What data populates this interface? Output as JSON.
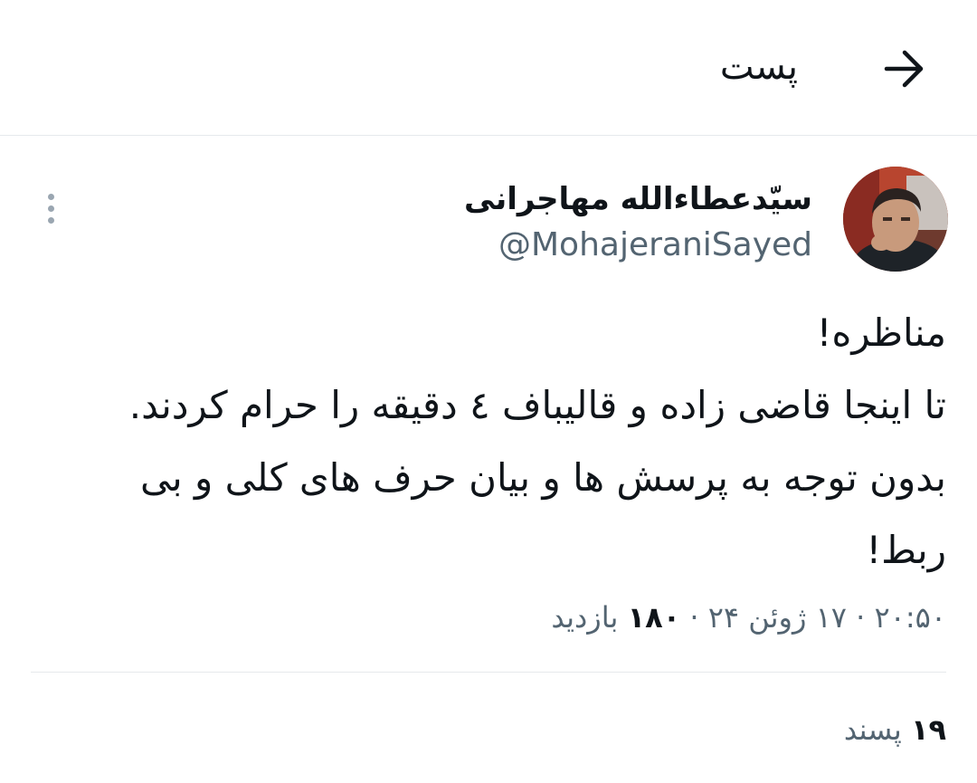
{
  "header": {
    "title": "پست",
    "back_icon": "arrow-right-icon"
  },
  "tweet": {
    "author": {
      "display_name": "سیّدعطاءالله مهاجرانی",
      "handle": "@MohajeraniSayed",
      "avatar_icon": "profile-photo"
    },
    "more_icon": "more-vertical-icon",
    "body_lines": [
      "مناظره!",
      "تا اینجا قاضی زاده و قالیباف ٤ دقیقه را حرام کردند.",
      "بدون توجه به پرسش ها و بیان حرف های کلی و بی",
      "ربط!"
    ],
    "meta": {
      "time": "۲۰:۵۰",
      "date": "۱۷ ژوئن ۲۴",
      "separator": "·",
      "views_count": "۱۸۰",
      "views_label": "بازدید"
    },
    "stats": {
      "likes_count": "۱۹",
      "likes_label": "پسند"
    }
  },
  "colors": {
    "text_primary": "#0f1419",
    "text_secondary": "#536471",
    "divider": "#e6e9ec",
    "icon_muted": "#9aa6b1"
  }
}
